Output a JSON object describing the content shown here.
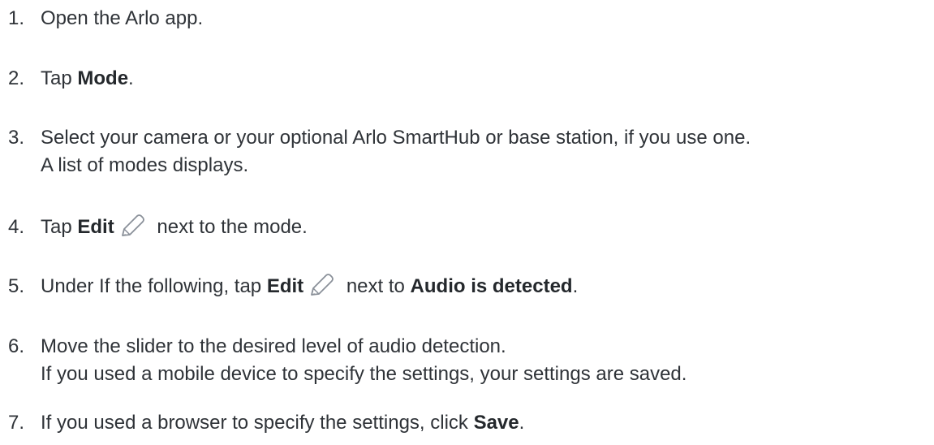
{
  "steps": [
    {
      "number": "1.",
      "text": "Open the Arlo app."
    },
    {
      "number": "2.",
      "pre": "Tap ",
      "bold": "Mode",
      "post": "."
    },
    {
      "number": "3.",
      "line1": "Select your camera or your optional Arlo SmartHub or base station, if you use one.",
      "line2": "A list of modes displays."
    },
    {
      "number": "4.",
      "pre": "Tap ",
      "bold": "Edit",
      "post": " next to the mode.",
      "icon": "pencil-edit-icon"
    },
    {
      "number": "5.",
      "pre": "Under If the following, tap ",
      "bold": "Edit",
      "mid": " next to ",
      "bold2": "Audio is detected",
      "post": ".",
      "icon": "pencil-edit-icon"
    },
    {
      "number": "6.",
      "line1": "Move the slider to the desired level of audio detection.",
      "line2": "If you used a mobile device to specify the settings, your settings are saved."
    },
    {
      "number": "7.",
      "pre": "If you used a browser to specify the settings, click ",
      "bold": "Save",
      "post": "."
    }
  ],
  "colors": {
    "text": "#2f3338",
    "icon_stroke": "#8a9099"
  }
}
